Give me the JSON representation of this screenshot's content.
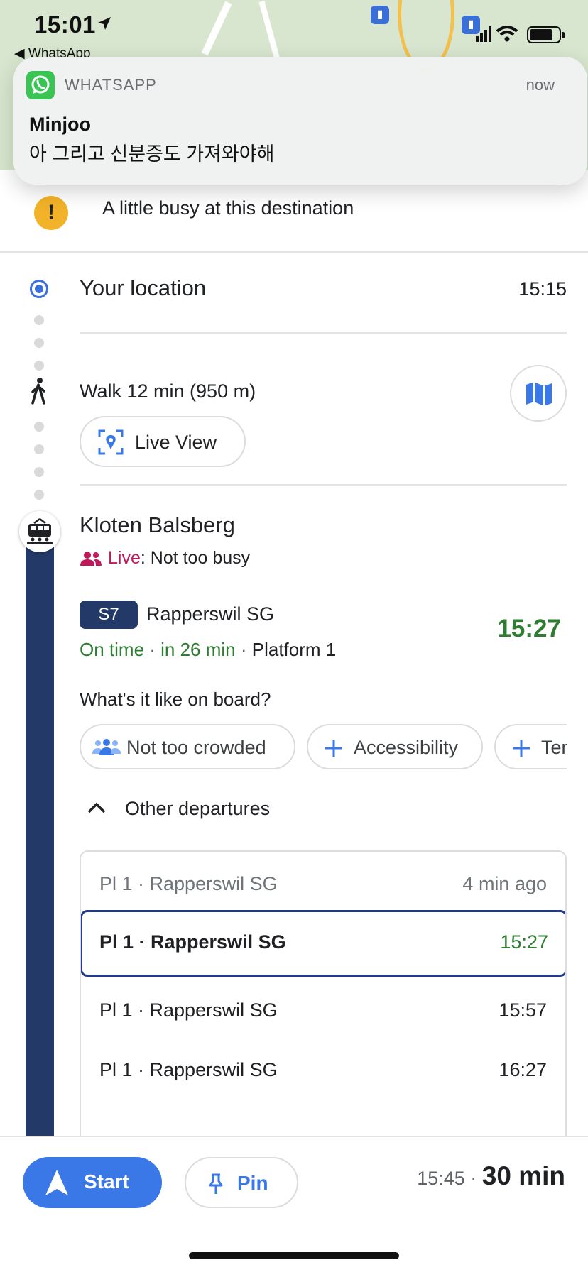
{
  "status_bar": {
    "time": "15:01",
    "back_app": "◀ WhatsApp"
  },
  "notification": {
    "app": "WHATSAPP",
    "when": "now",
    "sender": "Minjoo",
    "message": "아 그리고 신분증도 가져와야해"
  },
  "alert": {
    "text": "A little busy at this destination"
  },
  "origin": {
    "label": "Your location",
    "time": "15:15"
  },
  "walk": {
    "text": "Walk 12 min (950 m)",
    "live_view_label": "Live View"
  },
  "transit": {
    "station": "Kloten Balsberg",
    "live_label": "Live",
    "live_value": ": Not too busy",
    "line": "S7",
    "destination": "Rapperswil SG",
    "departure_time": "15:27",
    "on_time": "On time",
    "sep1": " · ",
    "in_min": "in 26 min",
    "sep2": " · ",
    "platform": "Platform 1",
    "onboard_question": "What's it like on board?",
    "chips": [
      "Not too crowded",
      "Accessibility",
      "Temperature"
    ]
  },
  "other_departures": {
    "title": "Other departures",
    "rows": [
      {
        "label": "Pl 1 · Rapperswil SG",
        "time": "4 min ago"
      },
      {
        "label": "Pl 1 · Rapperswil SG",
        "time": "15:27"
      },
      {
        "label": "Pl 1 · Rapperswil SG",
        "time": "15:57"
      },
      {
        "label": "Pl 1 · Rapperswil SG",
        "time": "16:27"
      }
    ]
  },
  "bottom_bar": {
    "start_label": "Start",
    "pin_label": "Pin",
    "arrival": "15:45",
    "sep": " · ",
    "duration": "30 min"
  },
  "colors": {
    "accent_blue": "#3b78e7",
    "transit_navy": "#233a68",
    "on_time_green": "#2e7d32",
    "live_pink": "#c2185b",
    "alert_yellow": "#f2b32a"
  }
}
